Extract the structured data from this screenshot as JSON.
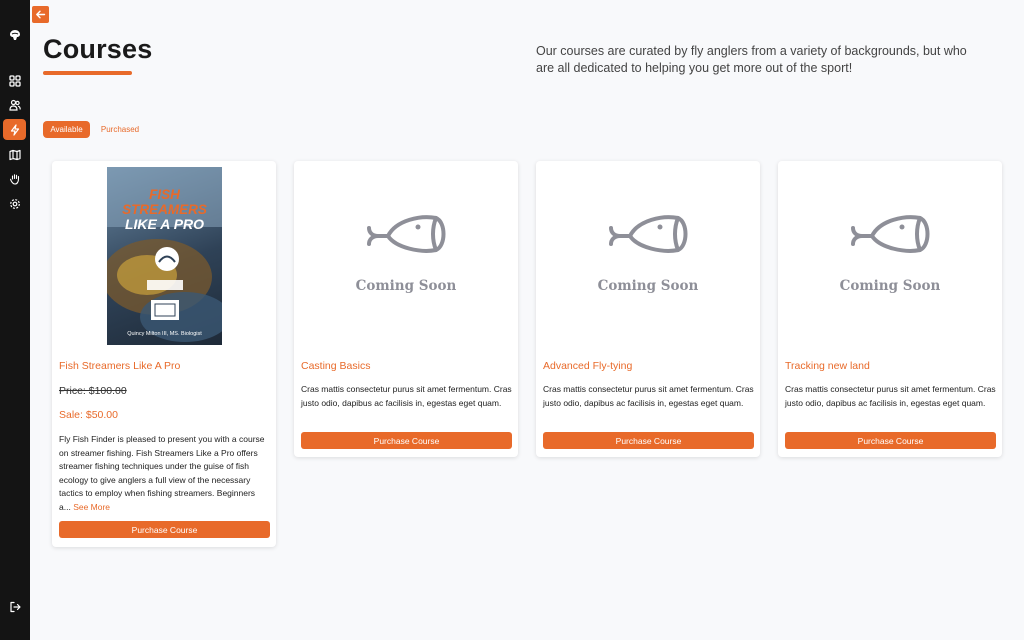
{
  "sidebar": {
    "icons": [
      "logo-icon",
      "grid-icon",
      "users-icon",
      "lightning-icon",
      "map-icon",
      "hand-icon",
      "settings-icon",
      "logout-icon"
    ]
  },
  "header": {
    "title": "Courses",
    "intro": "Our courses are curated by fly anglers from a variety of backgrounds, but who are all dedicated to helping you get more out of the sport!"
  },
  "tabs": {
    "available": "Available",
    "purchased": "Purchased"
  },
  "accent_color": "#e86a2a",
  "courses": [
    {
      "title": "Fish Streamers Like A Pro",
      "cover": {
        "line1": "FISH STREAMERS",
        "line2": "LIKE A PRO",
        "author": "Quincy Milton III, MS. Biologist"
      },
      "price": "Price: $100.00",
      "sale": "Sale: $50.00",
      "description": "Fly Fish Finder is pleased to present you with a course on streamer fishing. Fish Streamers Like a Pro offers streamer fishing techniques under the guise of fish ecology to give anglers a full view of the necessary tactics to employ when fishing streamers. Beginners a...",
      "see_more": "See More",
      "button": "Purchase Course"
    },
    {
      "title": "Casting Basics",
      "placeholder": "Coming Soon",
      "description": "Cras mattis consectetur purus sit amet fermentum. Cras justo odio, dapibus ac facilisis in, egestas eget quam.",
      "button": "Purchase Course"
    },
    {
      "title": "Advanced Fly-tying",
      "placeholder": "Coming Soon",
      "description": "Cras mattis consectetur purus sit amet fermentum. Cras justo odio, dapibus ac facilisis in, egestas eget quam.",
      "button": "Purchase Course"
    },
    {
      "title": "Tracking new land",
      "placeholder": "Coming Soon",
      "description": "Cras mattis consectetur purus sit amet fermentum. Cras justo odio, dapibus ac facilisis in, egestas eget quam.",
      "button": "Purchase Course"
    }
  ]
}
